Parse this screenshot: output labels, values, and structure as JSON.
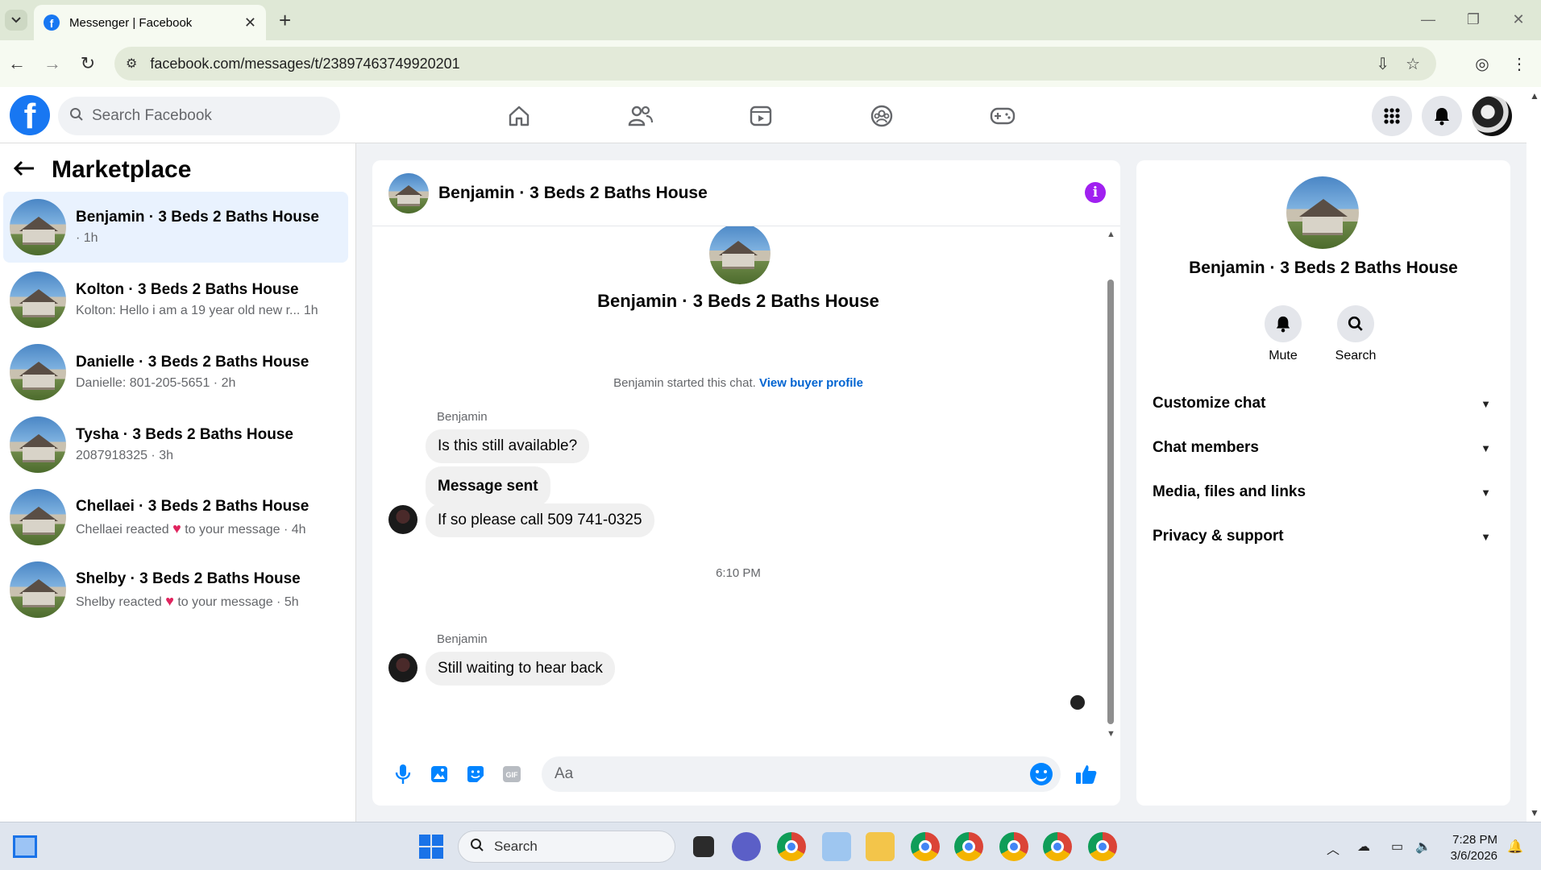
{
  "browser": {
    "tab_title": "Messenger | Facebook",
    "url": "facebook.com/messages/t/23897463749920201"
  },
  "fb": {
    "search_placeholder": "Search Facebook"
  },
  "sidebar": {
    "title": "Marketplace",
    "conversations": [
      {
        "name": "Benjamin · 3 Beds 2 Baths House",
        "snippet": "· 1h",
        "active": true
      },
      {
        "name": "Kolton · 3 Beds 2 Baths House",
        "snippet": "Kolton: Hello i am a 19 year old new r...   1h"
      },
      {
        "name": "Danielle · 3 Beds 2 Baths House",
        "snippet": "Danielle: 801-205-5651 · 2h"
      },
      {
        "name": "Tysha · 3 Beds 2 Baths House",
        "snippet": "2087918325 · 3h"
      },
      {
        "name": "Chellaei · 3 Beds 2 Baths House",
        "snippet_pre": "Chellaei reacted",
        "snippet_post": "to your message · 4h"
      },
      {
        "name": "Shelby · 3 Beds 2 Baths House",
        "snippet_pre": "Shelby reacted",
        "snippet_post": "to your message · 5h"
      }
    ]
  },
  "chat": {
    "title": "Benjamin · 3 Beds 2 Baths House",
    "big_name": "Benjamin · 3 Beds 2 Baths House",
    "started_text": "Benjamin started this chat.",
    "view_profile": "View buyer profile",
    "messages": {
      "sender1": "Benjamin",
      "m1": "Is this still available?",
      "m2": "Message sent",
      "m3": "If so please call 509 741-0325",
      "time": "6:10 PM",
      "sender2": "Benjamin",
      "m4": "Still waiting to hear back"
    },
    "composer_placeholder": "Aa"
  },
  "info_panel": {
    "name": "Benjamin · 3 Beds 2 Baths House",
    "mute": "Mute",
    "search": "Search",
    "rows": [
      "Customize chat",
      "Chat members",
      "Media, files and links",
      "Privacy & support"
    ]
  },
  "taskbar": {
    "search": "Search",
    "time": "7:28 PM",
    "date": "3/6/2026"
  },
  "colors": {
    "fb_blue": "#1877f2",
    "messenger_blue": "#0084ff",
    "info_purple": "#a020f0",
    "active_row": "#e9f2fe"
  }
}
